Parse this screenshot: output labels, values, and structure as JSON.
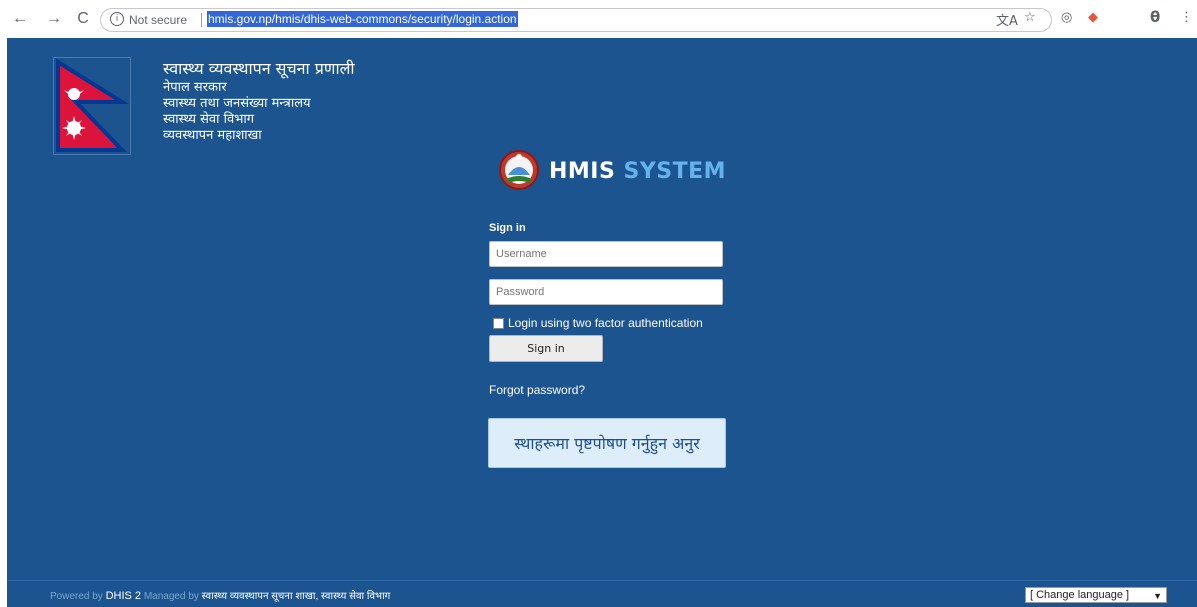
{
  "browser": {
    "back_icon": "←",
    "forward_icon": "→",
    "reload_icon": "C",
    "info_icon": "i",
    "security_label": "Not secure",
    "url": "hmis.gov.np/hmis/dhis-web-commons/security/login.action",
    "translate_icon": "文A",
    "star_icon": "☆",
    "extension_icon": "◎",
    "extension2_icon": "◆",
    "profile_icon": "θ",
    "menu_icon": "⋮"
  },
  "header": {
    "title": "स्वास्थ्य व्यवस्थापन सूचना प्रणाली",
    "lines": [
      "नेपाल सरकार",
      "स्वास्थ्य तथा जनसंख्या मन्त्रालय",
      "स्वास्थ्य सेवा विभाग",
      "व्यवस्थापन महाशाखा"
    ]
  },
  "brand": {
    "name_part1": "HMIS",
    "name_part2": "SYSTEM",
    "accent_color": "#64b4ea",
    "background_color": "#1c5490"
  },
  "login": {
    "heading": "Sign in",
    "username_placeholder": "Username",
    "password_placeholder": "Password",
    "two_factor_label": "Login using two factor authentication",
    "signin_button": "Sign in",
    "forgot_link": "Forgot password?",
    "feedback_text": "स्थाहरूमा पृष्टपोषण गर्नुहुन अनुर"
  },
  "footer": {
    "powered_by": "Powered by",
    "dhis": "DHIS 2",
    "managed_by": "Managed by",
    "manager": "स्वास्थ्य व्यवस्थापन सूचना शाखा, स्वास्थ्य सेवा विभाग",
    "language_select": "[ Change language ]",
    "language_arrow": "▼"
  }
}
